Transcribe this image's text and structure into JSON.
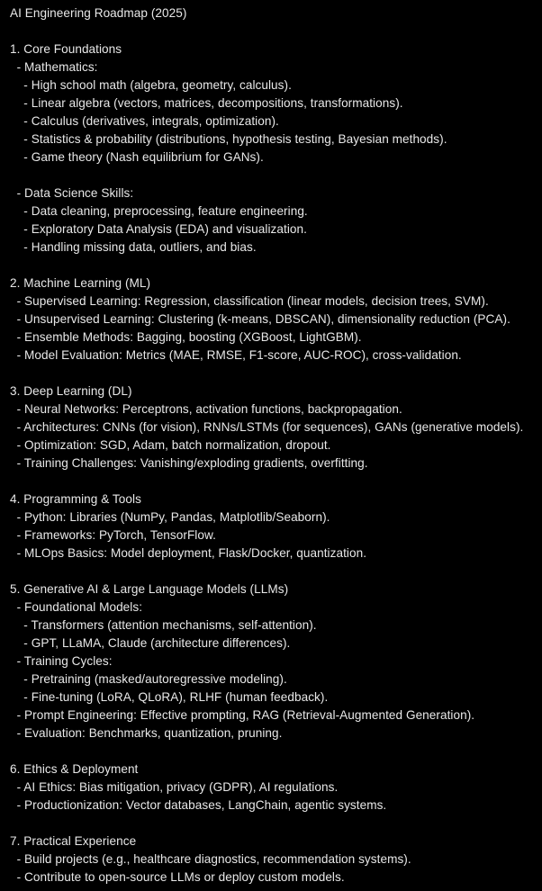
{
  "document": {
    "title": "AI Engineering Roadmap (2025)",
    "lines": [
      "1. Core Foundations",
      "  - Mathematics:",
      "    - High school math (algebra, geometry, calculus).",
      "    - Linear algebra (vectors, matrices, decompositions, transformations).",
      "    - Calculus (derivatives, integrals, optimization).",
      "    - Statistics & probability (distributions, hypothesis testing, Bayesian methods).",
      "    - Game theory (Nash equilibrium for GANs).",
      "",
      "  - Data Science Skills:",
      "    - Data cleaning, preprocessing, feature engineering.",
      "    - Exploratory Data Analysis (EDA) and visualization.",
      "    - Handling missing data, outliers, and bias.",
      "",
      "2. Machine Learning (ML)",
      "  - Supervised Learning: Regression, classification (linear models, decision trees, SVM).",
      "  - Unsupervised Learning: Clustering (k-means, DBSCAN), dimensionality reduction (PCA).",
      "  - Ensemble Methods: Bagging, boosting (XGBoost, LightGBM).",
      "  - Model Evaluation: Metrics (MAE, RMSE, F1-score, AUC-ROC), cross-validation.",
      "",
      "3. Deep Learning (DL)",
      "  - Neural Networks: Perceptrons, activation functions, backpropagation.",
      "  - Architectures: CNNs (for vision), RNNs/LSTMs (for sequences), GANs (generative models).",
      "  - Optimization: SGD, Adam, batch normalization, dropout.",
      "  - Training Challenges: Vanishing/exploding gradients, overfitting.",
      "",
      "4. Programming & Tools",
      "  - Python: Libraries (NumPy, Pandas, Matplotlib/Seaborn).",
      "  - Frameworks: PyTorch, TensorFlow.",
      "  - MLOps Basics: Model deployment, Flask/Docker, quantization.",
      "",
      "5. Generative AI & Large Language Models (LLMs)",
      "  - Foundational Models:",
      "    - Transformers (attention mechanisms, self-attention).",
      "    - GPT, LLaMA, Claude (architecture differences).",
      "  - Training Cycles:",
      "    - Pretraining (masked/autoregressive modeling).",
      "    - Fine-tuning (LoRA, QLoRA), RLHF (human feedback).",
      "  - Prompt Engineering: Effective prompting, RAG (Retrieval-Augmented Generation).",
      "  - Evaluation: Benchmarks, quantization, pruning.",
      "",
      "6. Ethics & Deployment",
      "  - AI Ethics: Bias mitigation, privacy (GDPR), AI regulations.",
      "  - Productionization: Vector databases, LangChain, agentic systems.",
      "",
      "7. Practical Experience",
      "  - Build projects (e.g., healthcare diagnostics, recommendation systems).",
      "  - Contribute to open-source LLMs or deploy custom models."
    ]
  }
}
